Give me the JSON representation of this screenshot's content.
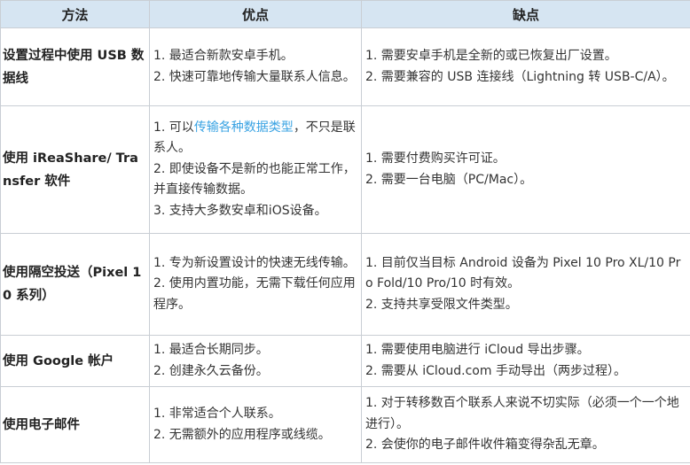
{
  "header": {
    "method": "方法",
    "pros": "优点",
    "cons": "缺点"
  },
  "rows": [
    {
      "method": "设置过程中使用 USB 数据线",
      "pros": [
        "1. 最适合新款安卓手机。",
        "2. 快速可靠地传输大量联系人信息。"
      ],
      "cons": [
        "1. 需要安卓手机是全新的或已恢复出厂设置。",
        "2. 需要兼容的 USB 连接线（Lightning 转 USB-C/A）。"
      ]
    },
    {
      "method": "使用 iReaShare/ Transfer 软件",
      "pros_first": {
        "prefix": "1. 可以",
        "link": "传输各种数据类型",
        "suffix": "，不只是联系人。"
      },
      "pros": [
        "2. 即使设备不是新的也能正常工作，并直接传输数据。",
        "3. 支持大多数安卓和iOS设备。"
      ],
      "cons": [
        "1. 需要付费购买许可证。",
        "2. 需要一台电脑（PC/Mac）。"
      ]
    },
    {
      "method": "使用隔空投送（Pixel 10 系列）",
      "pros": [
        "1. 专为新设置设计的快速无线传输。",
        "2. 使用内置功能，无需下载任何应用程序。"
      ],
      "cons": [
        "1. 目前仅当目标 Android 设备为 Pixel 10 Pro XL/10 Pro Fold/10 Pro/10 时有效。",
        "2. 支持共享受限文件类型。"
      ]
    },
    {
      "method": "使用 Google 帐户",
      "pros": [
        "1. 最适合长期同步。",
        "2. 创建永久云备份。"
      ],
      "cons": [
        "1. 需要使用电脑进行 iCloud 导出步骤。",
        "2. 需要从 iCloud.com 手动导出（两步过程）。"
      ]
    },
    {
      "method": "使用电子邮件",
      "pros": [
        "1. 非常适合个人联系。",
        "2. 无需额外的应用程序或线缆。"
      ],
      "cons": [
        "1. 对于转移数百个联系人来说不切实际（必须一个一个地进行）。",
        "2. 会使你的电子邮件收件箱变得杂乱无章。"
      ]
    }
  ]
}
